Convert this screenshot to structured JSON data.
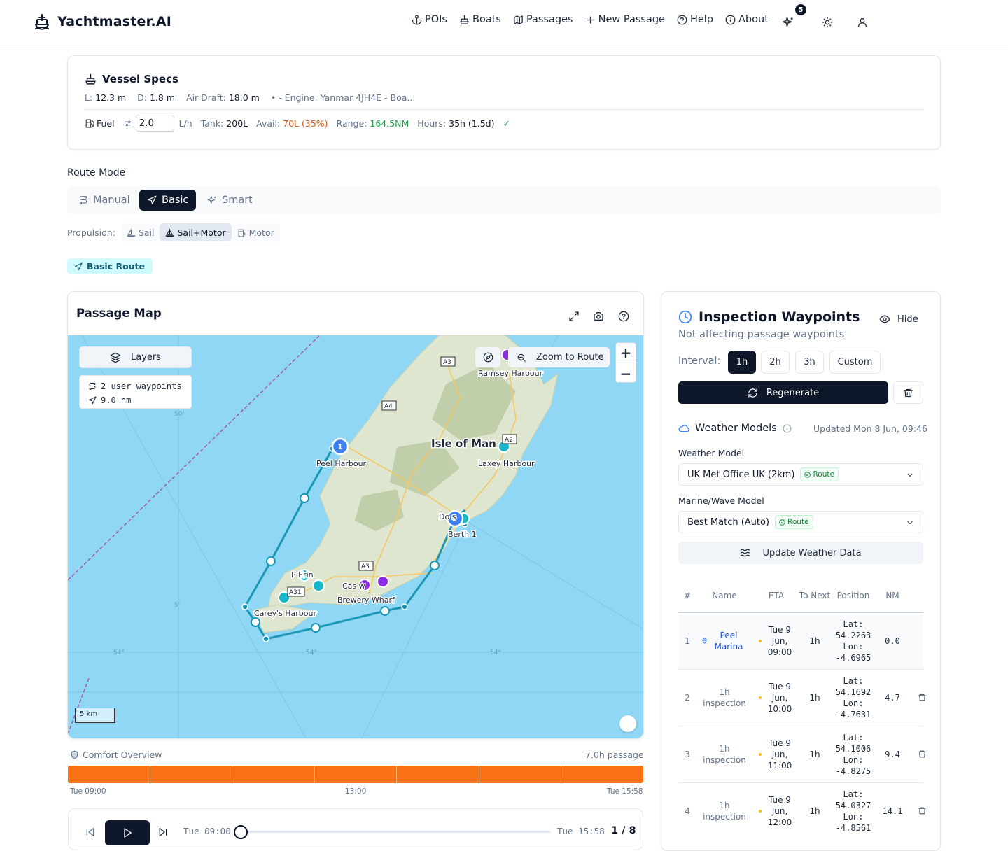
{
  "header": {
    "brand": "Yachtmaster.AI",
    "nav": [
      {
        "label": "POIs",
        "icon": "anchor-icon"
      },
      {
        "label": "Boats",
        "icon": "ship-icon"
      },
      {
        "label": "Passages",
        "icon": "map-icon"
      },
      {
        "label": "New Passage",
        "icon": "plus-icon"
      },
      {
        "label": "Help",
        "icon": "help-circle-icon"
      },
      {
        "label": "About",
        "icon": "info-icon"
      }
    ],
    "notifications_count": "5"
  },
  "vessel": {
    "title": "Vessel Specs",
    "length_label": "L:",
    "length": "12.3 m",
    "draft_label": "D:",
    "draft": "1.8 m",
    "air_draft_label": "Air Draft:",
    "air_draft": "18.0 m",
    "extra": "• - Engine: Yanmar 4JH4E - Boa...",
    "fuel_label": "Fuel",
    "fuel_rate": "2.0",
    "fuel_unit": "L/h",
    "tank_label": "Tank:",
    "tank": "200L",
    "avail_label": "Avail:",
    "avail": "70L (35%)",
    "range_label": "Range:",
    "range": "164.5NM",
    "hours_label": "Hours:",
    "hours": "35h (1.5d)",
    "check": "✓"
  },
  "route_mode": {
    "label": "Route Mode",
    "options": [
      "Manual",
      "Basic",
      "Smart"
    ],
    "active": "Basic"
  },
  "propulsion": {
    "label": "Propulsion:",
    "options": [
      "Sail",
      "Sail+Motor",
      "Motor"
    ],
    "active": "Sail+Motor"
  },
  "route_badge": "Basic Route",
  "map": {
    "title": "Passage Map",
    "layers_label": "Layers",
    "waypoints_info": "2 user waypoints",
    "distance_info": "9.0 nm",
    "zoom_to_route": "Zoom to Route",
    "scale": "5 km",
    "places": {
      "isle": "Isle of Man",
      "ramsey": "Ramsey Harbour",
      "peel": "Peel Harbour",
      "laxey": "Laxey Harbour",
      "douglas": "Do  s",
      "berth": "Berth 1",
      "port_erin": "P   Erin",
      "castletown": "Cas   w",
      "brewery": "Brewery Wharf",
      "careys": "Carey's Harbour"
    },
    "roads": [
      "A3",
      "A4",
      "A2",
      "A3",
      "A31"
    ],
    "graticule": [
      "50'",
      "54°",
      "54°",
      "54°",
      "5'"
    ],
    "markers": [
      "1",
      "2"
    ]
  },
  "comfort": {
    "label": "Comfort Overview",
    "duration": "7.0h passage",
    "segments": 7,
    "color": "#f97316",
    "start": "Tue 09:00",
    "mid": "13:00",
    "end": "Tue 15:58"
  },
  "player": {
    "start": "Tue 09:00",
    "end": "Tue 15:58",
    "counter": "1 / 8",
    "progress": 0
  },
  "inspection": {
    "title": "Inspection Waypoints",
    "hide_label": "Hide",
    "subtitle": "Not affecting passage waypoints",
    "interval_label": "Interval:",
    "intervals": [
      "1h",
      "2h",
      "3h",
      "Custom"
    ],
    "active_interval": "1h",
    "regenerate_label": "Regenerate",
    "weather_models_title": "Weather Models",
    "updated": "Updated Mon 8 Jun, 09:46",
    "weather_model_label": "Weather Model",
    "weather_model_value": "UK Met Office UK (2km)",
    "marine_model_label": "Marine/Wave Model",
    "marine_model_value": "Best Match (Auto)",
    "route_chip": "Route",
    "update_weather_label": "Update Weather Data",
    "columns": [
      "#",
      "Name",
      "ETA",
      "To Next",
      "Position",
      "NM"
    ],
    "rows": [
      {
        "num": "1",
        "name": "Peel Marina",
        "eta": "Tue 9 Jun, 09:00",
        "to_next": "1h",
        "lat": "Lat: 54.2263",
        "lon": "Lon: -4.6965",
        "nm": "0.0"
      },
      {
        "num": "2",
        "name": "1h inspection",
        "eta": "Tue 9 Jun, 10:00",
        "to_next": "1h",
        "lat": "Lat: 54.1692",
        "lon": "Lon: -4.7631",
        "nm": "4.7"
      },
      {
        "num": "3",
        "name": "1h inspection",
        "eta": "Tue 9 Jun, 11:00",
        "to_next": "1h",
        "lat": "Lat: 54.1006",
        "lon": "Lon: -4.8275",
        "nm": "9.4"
      },
      {
        "num": "4",
        "name": "1h inspection",
        "eta": "Tue 9 Jun, 12:00",
        "to_next": "1h",
        "lat": "Lat: 54.0327",
        "lon": "Lon: -4.8561",
        "nm": "14.1"
      }
    ]
  },
  "colors": {
    "dark": "#0f172a",
    "route": "#1b98b5",
    "marker": "#3b82f6",
    "poi_teal": "#17b6c9",
    "poi_purple": "#8b2be2",
    "sea": "#8fd7f5",
    "land": "#dfe6cf"
  }
}
